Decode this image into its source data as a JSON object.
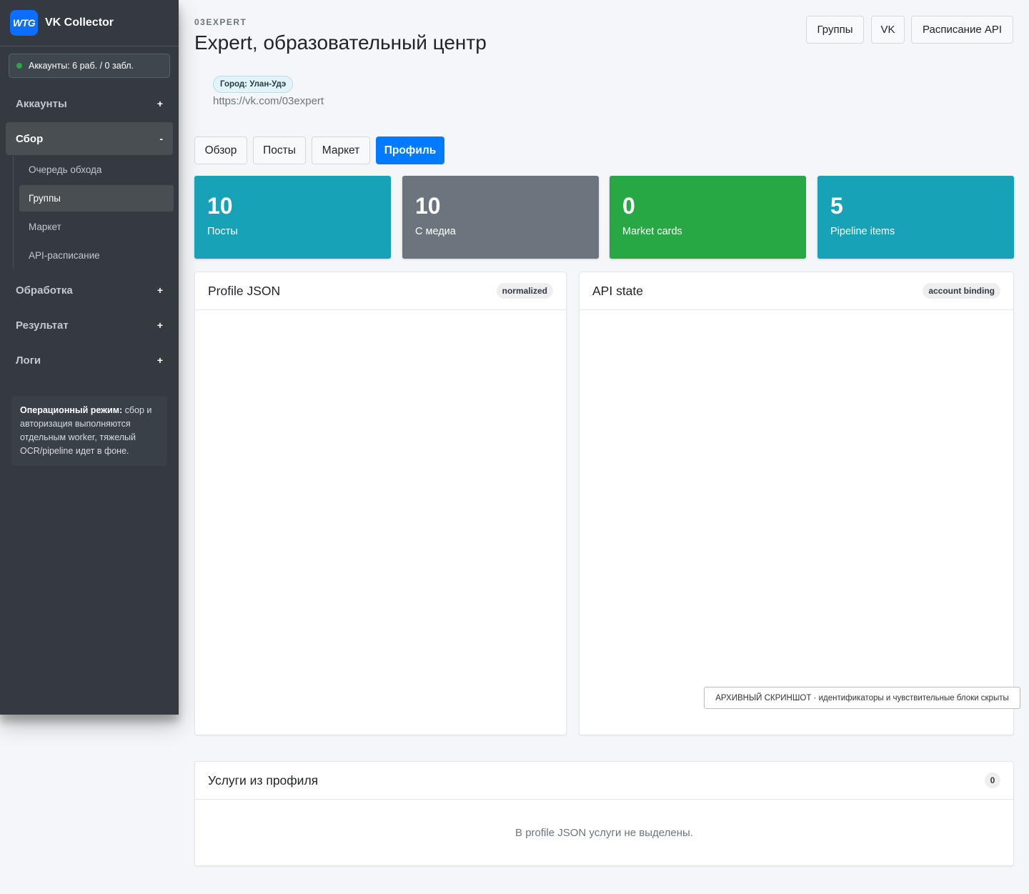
{
  "brand": {
    "logo": "WTG",
    "name": "VK Collector"
  },
  "account_status": {
    "text": "Аккаунты: 6 раб. / 0 забл.",
    "color": "#28a745"
  },
  "sidebar": {
    "sections": [
      {
        "label": "Аккаунты",
        "sign": "+"
      },
      {
        "label": "Сбор",
        "sign": "-"
      },
      {
        "label": "Обработка",
        "sign": "+"
      },
      {
        "label": "Результат",
        "sign": "+"
      },
      {
        "label": "Логи",
        "sign": "+"
      }
    ],
    "sub_items": [
      {
        "label": "Очередь обхода"
      },
      {
        "label": "Группы"
      },
      {
        "label": "Маркет"
      },
      {
        "label": "API-расписание"
      }
    ],
    "info": {
      "bold": "Операционный режим:",
      "text": " сбор и авторизация выполняются отдельным worker, тяжелый OCR/pipeline идет в фоне."
    }
  },
  "header": {
    "slug": "03EXPERT",
    "title": "Expert, образовательный центр",
    "buttons": [
      "Группы",
      "VK",
      "Расписание API"
    ],
    "city_badge": "Город: Улан-Удэ",
    "url": "https://vk.com/03expert"
  },
  "tabs": [
    "Обзор",
    "Посты",
    "Маркет",
    "Профиль"
  ],
  "active_tab": "Профиль",
  "stats": [
    {
      "value": "10",
      "label": "Посты",
      "color": "#17a2b8"
    },
    {
      "value": "10",
      "label": "С медиа",
      "color": "#6c757d"
    },
    {
      "value": "0",
      "label": "Market cards",
      "color": "#28a745"
    },
    {
      "value": "5",
      "label": "Pipeline items",
      "color": "#17a2b8"
    }
  ],
  "panels": {
    "profile_json": {
      "title": "Profile JSON",
      "badge": "normalized"
    },
    "api_state": {
      "title": "API state",
      "badge": "account binding"
    },
    "services": {
      "title": "Услуги из профиля",
      "count": "0",
      "empty": "В profile JSON услуги не выделены."
    }
  },
  "archive_note": "АРХИВНЫЙ СКРИНШОТ · идентификаторы и чувствительные блоки скрыты"
}
